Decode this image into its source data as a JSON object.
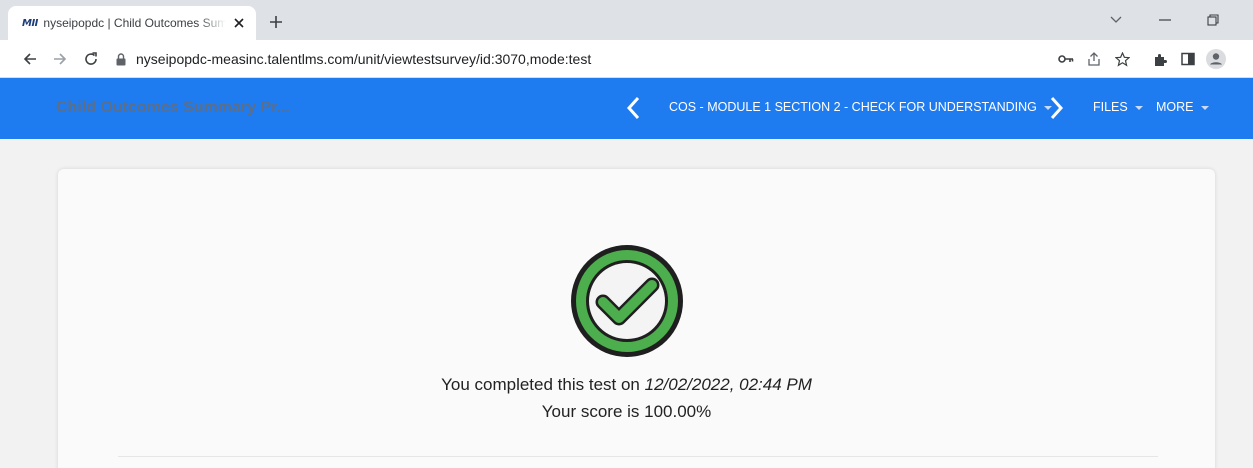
{
  "browser": {
    "tab_title": "nyseipopdc | Child Outcomes Summary Process",
    "favicon_text": "MII",
    "url": "nyseipopdc-measinc.talentlms.com/unit/viewtestsurvey/id:3070,mode:test"
  },
  "header": {
    "course_title": "Child Outcomes Summary Pr...",
    "unit_title": "COS - MODULE 1 SECTION 2 - CHECK FOR UNDERSTANDING",
    "files_label": "FILES",
    "more_label": "MORE",
    "bg_color": "#1e7bf0"
  },
  "result": {
    "completed_prefix": "You completed this test on",
    "completed_datetime": "12/02/2022, 02:44 PM",
    "score_text": "Your score is 100.00%",
    "check_color": "#4cae4c"
  }
}
